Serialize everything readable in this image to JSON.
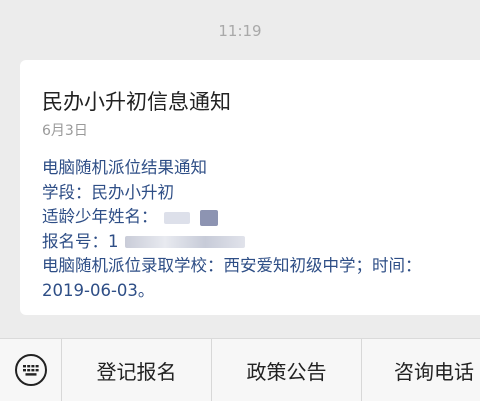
{
  "chat": {
    "time": "11:19"
  },
  "message": {
    "title": "民办小升初信息通知",
    "date": "6月3日",
    "lines": {
      "header": "电脑随机派位结果通知",
      "stage": "学段：民办小升初",
      "name_label": "适龄少年姓名：",
      "reg_label": "报名号：1",
      "result": "电脑随机派位录取学校：西安爱知初级中学；时间：",
      "datetime": "2019-06-03。"
    }
  },
  "menu": {
    "keyboard_icon": "keyboard-icon",
    "items": [
      {
        "label": "登记报名"
      },
      {
        "label": "政策公告"
      },
      {
        "label": "咨询电话"
      }
    ]
  }
}
